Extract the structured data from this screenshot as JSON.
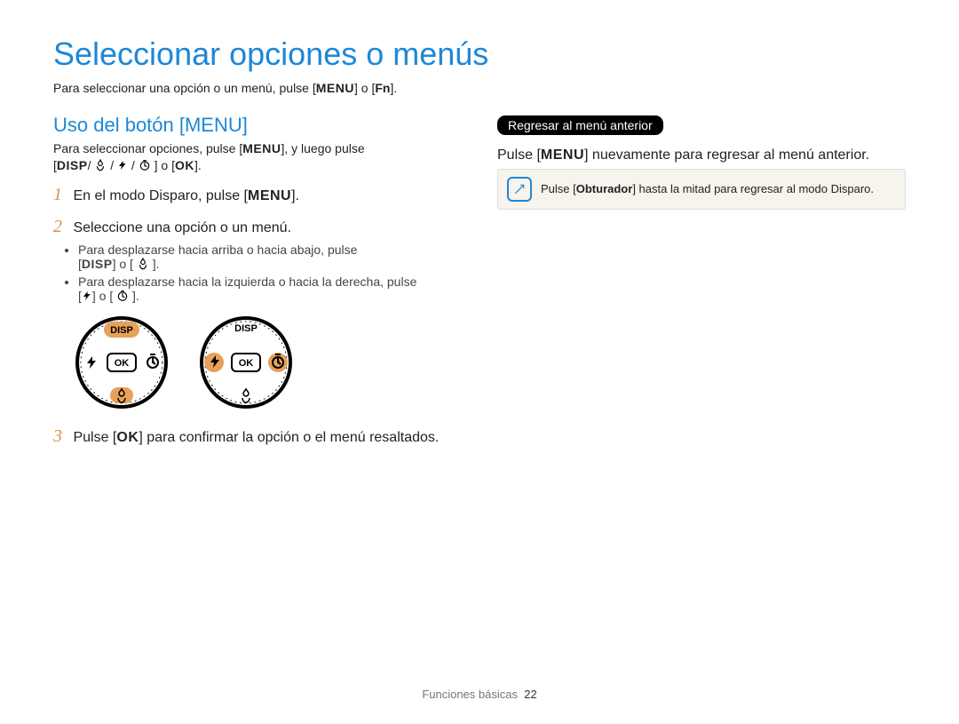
{
  "title": "Seleccionar opciones o menús",
  "intro_a": "Para seleccionar una opción o un menú, pulse [",
  "intro_b": "] o [",
  "intro_c": "].",
  "key_menu": "MENU",
  "key_fn": "Fn",
  "left": {
    "heading": "Uso del botón [MENU]",
    "p1a": "Para seleccionar opciones, pulse [",
    "p1b": "], y luego pulse",
    "disp": "DISP",
    "sep_slash": "/",
    "sep_o": " o ",
    "ok": "OK",
    "p1_end": "].",
    "step1_num": "1",
    "step1_a": "En el modo Disparo, pulse [",
    "step1_b": "].",
    "step2_num": "2",
    "step2": "Seleccione una opción o un menú.",
    "sub1_a": "Para desplazarse hacia arriba o hacia abajo, pulse",
    "sub1_b": "] o [",
    "sub1_c": "].",
    "sub2_a": "Para desplazarse hacia la izquierda o hacia la derecha, pulse",
    "sub2_b": "] o [",
    "sub2_c": "].",
    "step3_num": "3",
    "step3_a": "Pulse [",
    "step3_b": "] para confirmar la opción o el menú resaltados."
  },
  "right": {
    "pill": "Regresar al menú anterior",
    "p_a": "Pulse [",
    "p_b": "] nuevamente para regresar al menú anterior.",
    "tip_a": "Pulse [",
    "tip_key": "Obturador",
    "tip_b": "] hasta la mitad para regresar al modo Disparo."
  },
  "footer_label": "Funciones básicas",
  "footer_page": "22"
}
